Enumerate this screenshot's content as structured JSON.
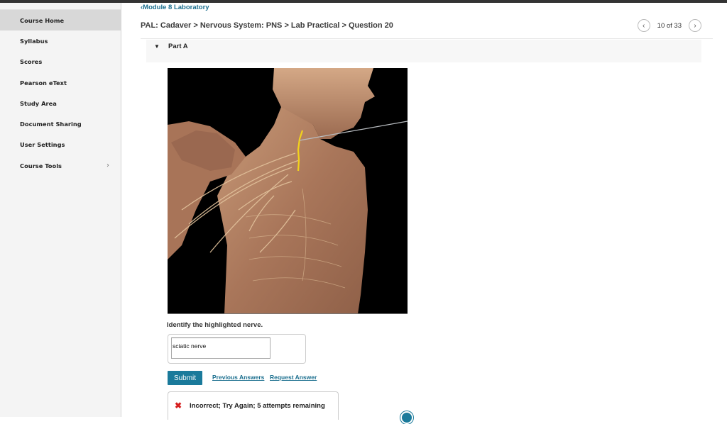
{
  "sidebar": {
    "items": [
      {
        "label": "Course Home",
        "active": true
      },
      {
        "label": "Syllabus"
      },
      {
        "label": "Scores"
      },
      {
        "label": "Pearson eText"
      },
      {
        "label": "Study Area"
      },
      {
        "label": "Document Sharing"
      },
      {
        "label": "User Settings"
      },
      {
        "label": "Course Tools",
        "chevron": "›"
      }
    ]
  },
  "header": {
    "back_link": "‹Module 8 Laboratory",
    "breadcrumb": "PAL: Cadaver > Nervous System: PNS > Lab Practical > Question 20",
    "pager": {
      "prev_icon": "‹",
      "count": "10 of 33",
      "next_icon": "›"
    }
  },
  "part": {
    "toggle_icon": "▼",
    "label": "Part A"
  },
  "figure": {
    "description": "Cadaver dissection of neck and thorax with a highlighted nerve in yellow and a pointer pin",
    "highlight_color": "#f2d21c",
    "background": "#000000"
  },
  "question": {
    "prompt": "Identify the highlighted nerve.",
    "answer_value": "sciatic nerve"
  },
  "actions": {
    "submit_label": "Submit",
    "previous_answers_label": "Previous Answers",
    "request_answer_label": "Request Answer"
  },
  "feedback": {
    "icon": "✖",
    "message": "Incorrect; Try Again; 5 attempts remaining"
  },
  "colors": {
    "accent": "#1a7a9b",
    "link": "#1a6e8e",
    "error": "#d61f1f"
  }
}
